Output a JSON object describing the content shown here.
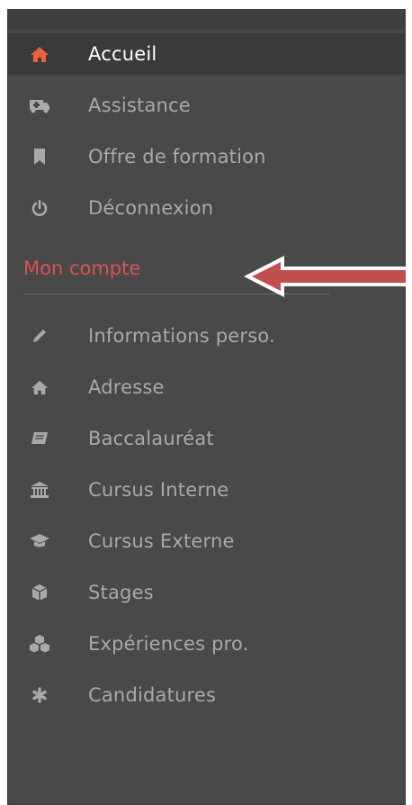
{
  "nav": {
    "items": [
      {
        "label": "Accueil",
        "icon": "home-icon",
        "active": true
      },
      {
        "label": "Assistance",
        "icon": "ambulance-icon"
      },
      {
        "label": "Offre de formation",
        "icon": "bookmark-icon"
      },
      {
        "label": "Déconnexion",
        "icon": "power-icon"
      }
    ]
  },
  "account": {
    "title": "Mon compte",
    "items": [
      {
        "label": "Informations perso.",
        "icon": "pencil-icon"
      },
      {
        "label": "Adresse",
        "icon": "home-icon"
      },
      {
        "label": "Baccalauréat",
        "icon": "book-icon"
      },
      {
        "label": "Cursus Interne",
        "icon": "institution-icon"
      },
      {
        "label": "Cursus Externe",
        "icon": "graduation-cap-icon"
      },
      {
        "label": "Stages",
        "icon": "cube-icon"
      },
      {
        "label": "Expériences pro.",
        "icon": "cubes-icon"
      },
      {
        "label": "Candidatures",
        "icon": "asterisk-icon"
      }
    ]
  },
  "colors": {
    "sidebar_bg": "#494949",
    "active_bg": "#3a3a3a",
    "accent": "#d9534f",
    "text": "#a9a9a9",
    "arrow_fill": "#c0504d"
  }
}
